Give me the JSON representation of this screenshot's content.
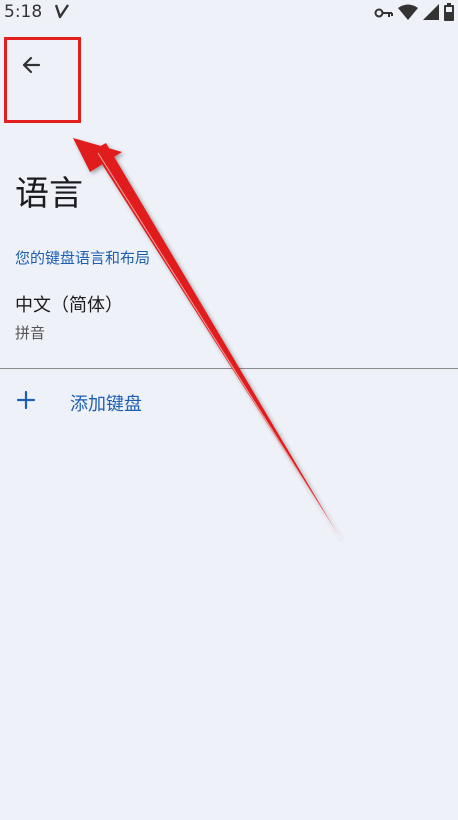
{
  "status_bar": {
    "time": "5:18",
    "icons": [
      "carrier-icon",
      "vpn-key-icon",
      "wifi-icon",
      "signal-icon",
      "battery-icon"
    ]
  },
  "toolbar": {
    "back_icon": "arrow-left-icon"
  },
  "page": {
    "title": "语言",
    "section_header": "您的键盘语言和布局"
  },
  "languages": [
    {
      "name": "中文（简体）",
      "layout": "拼音"
    }
  ],
  "actions": {
    "add_keyboard_label": "添加键盘",
    "add_icon": "plus-icon"
  },
  "colors": {
    "background": "#eef2f8",
    "accent": "#1e5fb0",
    "annotation": "#e11f1f"
  }
}
